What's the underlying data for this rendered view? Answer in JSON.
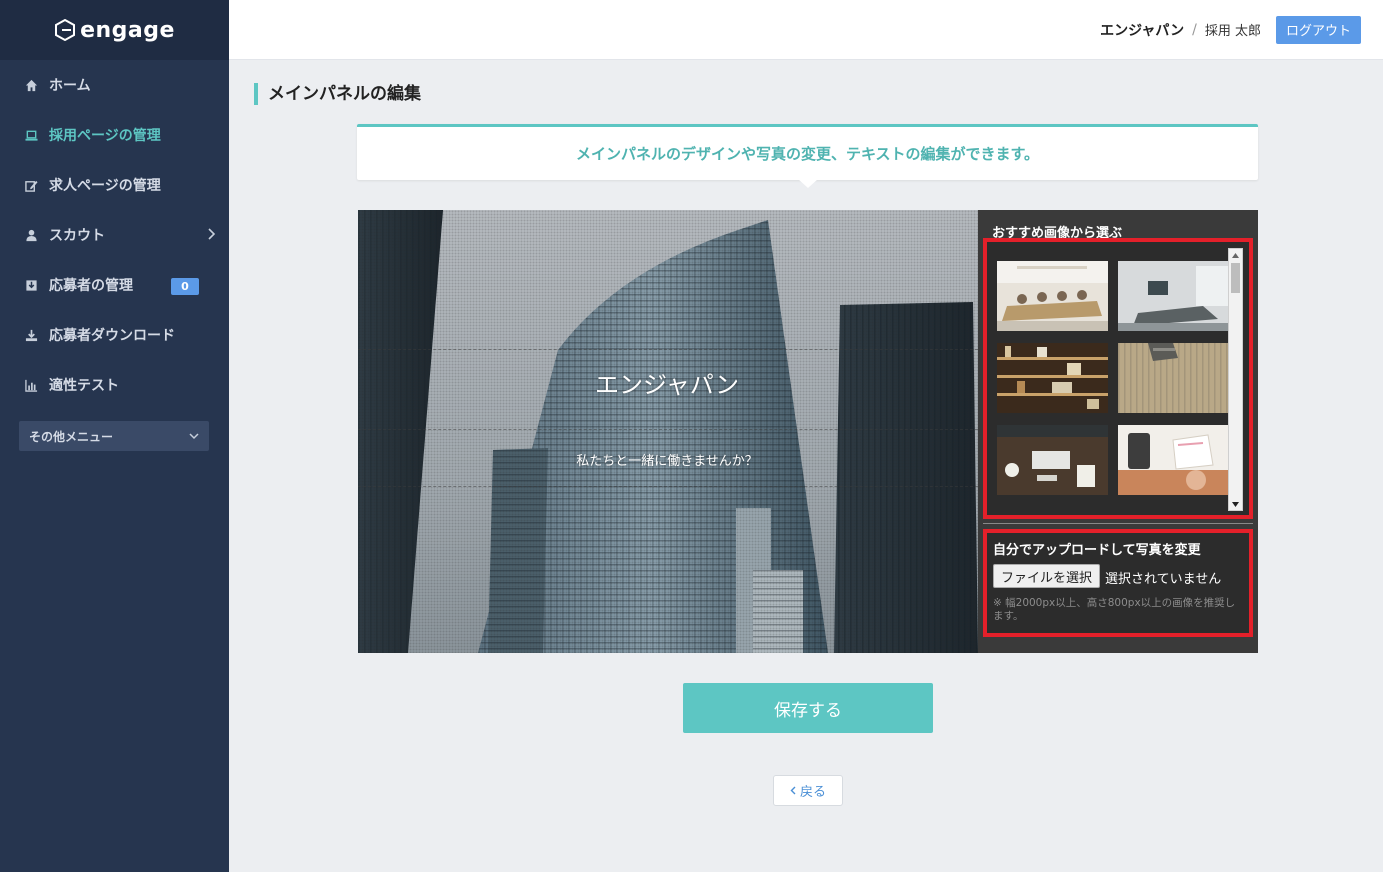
{
  "brand": {
    "name": "engage"
  },
  "header": {
    "company": "エンジャパン",
    "separator": "/",
    "user": "採用 太郎",
    "logout_label": "ログアウト"
  },
  "sidebar": {
    "items": [
      {
        "label": "ホーム",
        "icon": "home-icon"
      },
      {
        "label": "採用ページの管理",
        "icon": "laptop-icon",
        "active": true
      },
      {
        "label": "求人ページの管理",
        "icon": "edit-icon"
      },
      {
        "label": "スカウト",
        "icon": "user-icon"
      },
      {
        "label": "応募者の管理",
        "icon": "download-box-icon",
        "badge": "0"
      },
      {
        "label": "応募者ダウンロード",
        "icon": "download-icon"
      },
      {
        "label": "適性テスト",
        "icon": "bar-chart-icon"
      }
    ],
    "other_menu_label": "その他メニュー"
  },
  "page": {
    "title": "メインパネルの編集",
    "info": "メインパネルのデザインや写真の変更、テキストの編集ができます。"
  },
  "hero": {
    "title": "エンジャパン",
    "subtitle": "私たちと一緒に働きませんか？"
  },
  "panel": {
    "recommended_label": "おすすめ画像から選ぶ",
    "upload_title": "自分でアップロードして写真を変更",
    "file_button": "ファイルを選択",
    "file_status": "選択されていません",
    "note": "※ 幅2000px以上、高さ800px以上の画像を推奨します。"
  },
  "actions": {
    "save_label": "保存する",
    "back_label": "戻る"
  },
  "colors": {
    "sidebar": "#26354f",
    "accent": "#5dc6c3",
    "blue": "#5b9ae8",
    "highlight": "#e4202a"
  }
}
